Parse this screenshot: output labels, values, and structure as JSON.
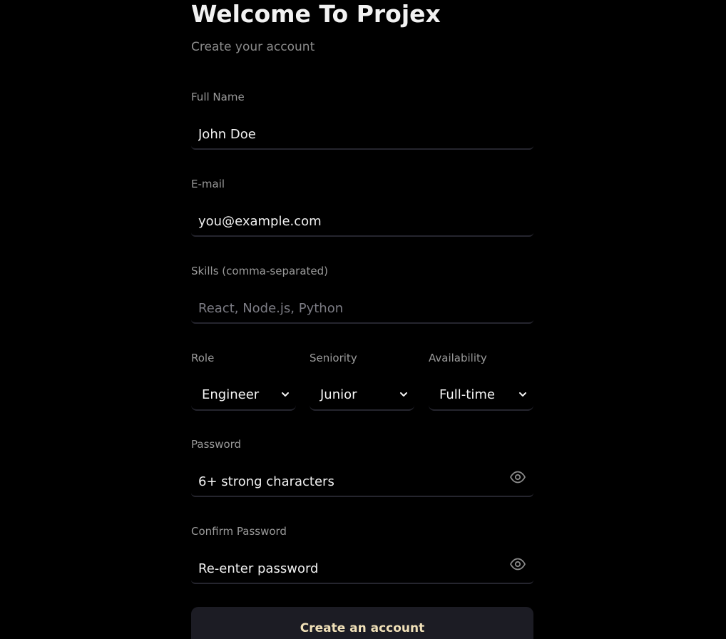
{
  "header": {
    "title": "Welcome To Projex",
    "subtitle": "Create your account"
  },
  "fields": {
    "full_name": {
      "label": "Full Name",
      "placeholder": "John Doe"
    },
    "email": {
      "label": "E-mail",
      "placeholder": "you@example.com"
    },
    "skills": {
      "label": "Skills (comma-separated)",
      "placeholder": "React, Node.js, Python"
    },
    "role": {
      "label": "Role",
      "value": "Engineer"
    },
    "seniority": {
      "label": "Seniority",
      "value": "Junior"
    },
    "availability": {
      "label": "Availability",
      "value": "Full-time"
    },
    "password": {
      "label": "Password",
      "placeholder": "6+ strong characters",
      "icon": "eye-icon"
    },
    "confirm_password": {
      "label": "Confirm Password",
      "placeholder": "Re-enter password",
      "icon": "eye-icon"
    }
  },
  "actions": {
    "submit_label": "Create an account"
  },
  "colors": {
    "background": "#000000",
    "label": "#9a9a9a",
    "input_border": "#25252e",
    "button_bg": "#1c1c24",
    "button_text": "#f0e0b8"
  }
}
